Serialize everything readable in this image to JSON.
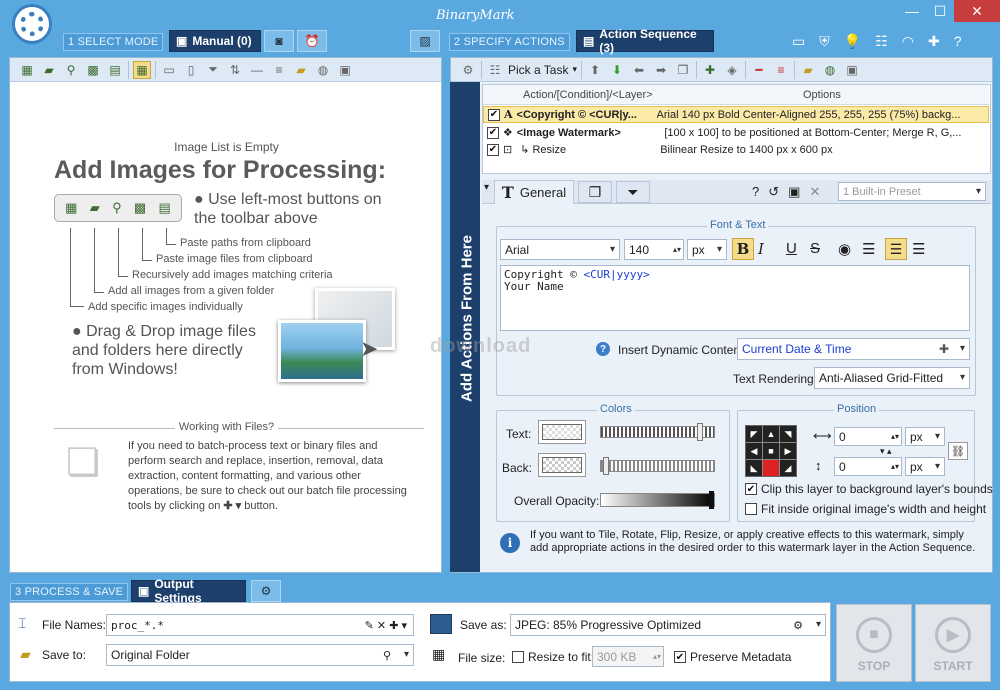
{
  "window": {
    "title": "BinaryMark",
    "min": "—",
    "max": "☐",
    "close": "✕"
  },
  "mode": {
    "step1": "1 SELECT MODE",
    "manual_tab": "Manual (0)",
    "step2": "2 SPECIFY ACTIONS",
    "actions_tab": "Action Sequence (3)",
    "step3": "3 PROCESS & SAVE",
    "output_tab": "Output Settings"
  },
  "left": {
    "image_list_status": "Image List is Empty",
    "heading": "Add Images for Processing:",
    "bullet1": "Use left-most buttons on the toolbar above",
    "callouts": [
      "Paste paths from clipboard",
      "Paste image files from clipboard",
      "Recursively add images matching criteria",
      "Add all images from a given folder",
      "Add specific images individually"
    ],
    "bullet2": "Drag & Drop image files and folders here directly from Windows!",
    "working_title": "Working with Files?",
    "working_text": "If you need to batch-process text or binary files and perform search and replace, insertion, removal, data extraction, content formatting, and various other operations, be sure to check out our batch file processing tools by clicking on",
    "working_end": "button."
  },
  "right": {
    "pick_task": "Pick a Task",
    "add_actions": "Add Actions From Here",
    "col_action": "Action/[Condition]/<Layer>",
    "col_options": "Options",
    "rows": [
      {
        "name": "<Copyright © <CUR|y...",
        "options": "Arial 140 px Bold Center-Aligned 255, 255, 255 (75%) backg..."
      },
      {
        "name": "<Image Watermark>",
        "options": "[100 x 100] to be positioned at Bottom-Center; Merge R, G,..."
      },
      {
        "name": "↳ Resize",
        "options": "Bilinear Resize to 1400 px x 600 px"
      }
    ],
    "tab_general": "General",
    "preset": "1 Built-in Preset",
    "font_text_legend": "Font & Text",
    "font_name": "Arial",
    "font_size": "140",
    "font_unit": "px",
    "text_line1_prefix": "Copyright © ",
    "text_line1_token": "<CUR|yyyy>",
    "text_line2": "Your Name",
    "insert_dynamic_label": "Insert Dynamic Content:",
    "insert_dynamic_value": "Current Date & Time",
    "text_rendering_label": "Text Rendering:",
    "text_rendering_value": "Anti-Aliased Grid-Fitted",
    "colors_legend": "Colors",
    "text_label": "Text:",
    "back_label": "Back:",
    "opacity_label": "Overall Opacity:",
    "text_slider_level": 0.88,
    "back_slider_level": 0.02,
    "position_legend": "Position",
    "pos_x": "0",
    "pos_y": "0",
    "pos_unit": "px",
    "clip_label": "Clip this layer to background layer's bounds",
    "fit_label": "Fit inside original image's width and height",
    "info_text": "If you want to Tile, Rotate, Flip, Resize, or apply creative effects to this watermark, simply add appropriate actions in the desired order to this watermark layer in the Action Sequence."
  },
  "output": {
    "file_names_label": "File Names:",
    "file_names_value": "proc_*.*",
    "save_to_label": "Save to:",
    "save_to_value": "Original Folder",
    "save_as_label": "Save as:",
    "save_as_value": "JPEG: 85%  Progressive Optimized",
    "file_size_label": "File size:",
    "resize_to_fit_label": "Resize to fit:",
    "resize_to_fit_value": "300 KB",
    "preserve_metadata_label": "Preserve Metadata",
    "stop": "STOP",
    "start": "START"
  },
  "watermark": "download"
}
